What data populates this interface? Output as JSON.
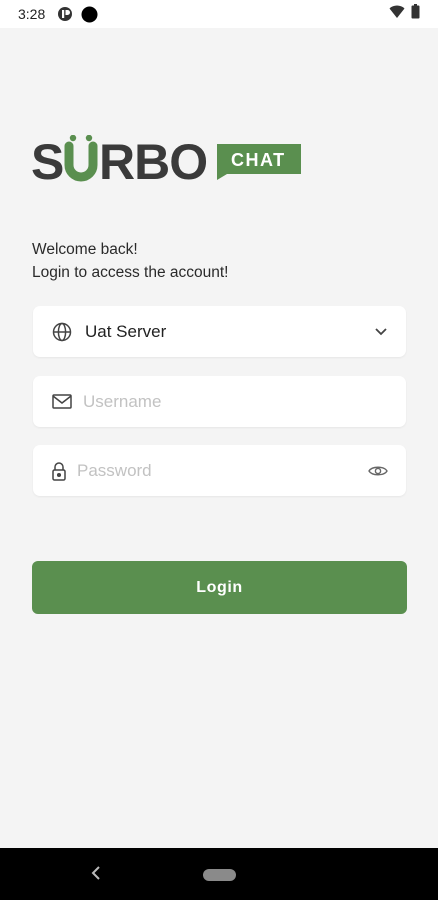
{
  "status_bar": {
    "time": "3:28",
    "icons": [
      "media-icon",
      "camera-dot-icon",
      "wifi-icon",
      "battery-icon"
    ]
  },
  "logo": {
    "brand": "SURBO",
    "tag": "CHAT",
    "colors": {
      "dark": "#3a3a3a",
      "green": "#5a8f4f"
    }
  },
  "welcome": {
    "line1": "Welcome back!",
    "line2": "Login to access the account!"
  },
  "form": {
    "server": {
      "value": "Uat Server",
      "icon": "globe-icon",
      "trailing_icon": "chevron-down-icon"
    },
    "username": {
      "placeholder": "Username",
      "icon": "mail-icon"
    },
    "password": {
      "placeholder": "Password",
      "icon": "lock-icon",
      "trailing_icon": "eye-icon"
    }
  },
  "login_button": {
    "label": "Login",
    "color": "#5a8f4f"
  },
  "nav_bar": {
    "icons": [
      "back-icon",
      "home-pill"
    ]
  }
}
